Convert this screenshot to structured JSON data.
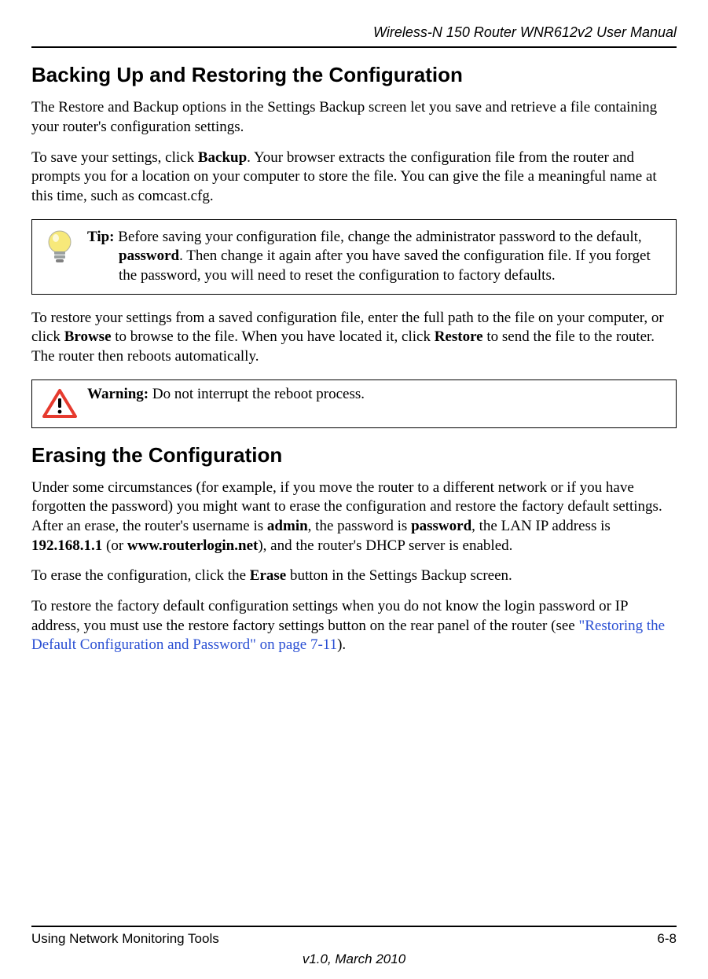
{
  "header": {
    "doc_title": "Wireless-N 150 Router WNR612v2 User Manual"
  },
  "section_backup": {
    "heading": "Backing Up and Restoring the Configuration",
    "p1": "The Restore and Backup options in the Settings Backup screen let you save and retrieve a file containing your router's configuration settings.",
    "p2_a": "To save your settings, click ",
    "p2_bold": "Backup",
    "p2_b": ". Your browser extracts the configuration file from the router and prompts you for a location on your computer to store the file. You can give the file a meaningful name at this time, such as comcast.cfg.",
    "tip_label": "Tip:",
    "tip_a": " Before saving your configuration file, change the administrator password to the default, ",
    "tip_bold": "password",
    "tip_b": ". Then change it again after you have saved the configuration file. If you forget the password, you will need to reset the configuration to factory defaults.",
    "p3_a": "To restore your settings from a saved configuration file, enter the full path to the file on your computer, or click ",
    "p3_bold1": "Browse",
    "p3_mid": " to browse to the file. When you have located it, click ",
    "p3_bold2": "Restore",
    "p3_b": " to send the file to the router. The router then reboots automatically.",
    "warn_label": "Warning:",
    "warn_text": " Do not interrupt the reboot process."
  },
  "section_erase": {
    "heading": "Erasing the Configuration",
    "p1_a": "Under some circumstances (for example, if you move the router to a different network or if you have forgotten the password) you might want to erase the configuration and restore the factory default settings. After an erase, the router's username is ",
    "p1_bold1": "admin",
    "p1_mid1": ", the password is ",
    "p1_bold2": "password",
    "p1_mid2": ", the LAN IP address is ",
    "p1_bold3": "192.168.1.1",
    "p1_mid3": " (or ",
    "p1_bold4": "www.routerlogin.net",
    "p1_b": "), and the router's DHCP server is enabled.",
    "p2_a": "To erase the configuration, click the ",
    "p2_bold": "Erase",
    "p2_b": " button in the Settings Backup screen.",
    "p3_a": "To restore the factory default configuration settings when you do not know the login password or IP address, you must use the restore factory settings button on the rear panel of the router (see ",
    "p3_link": "\"Restoring the Default Configuration and Password\" on page 7-11",
    "p3_b": ")."
  },
  "footer": {
    "left": "Using Network Monitoring Tools",
    "right": "6-8",
    "bottom": "v1.0, March 2010"
  }
}
